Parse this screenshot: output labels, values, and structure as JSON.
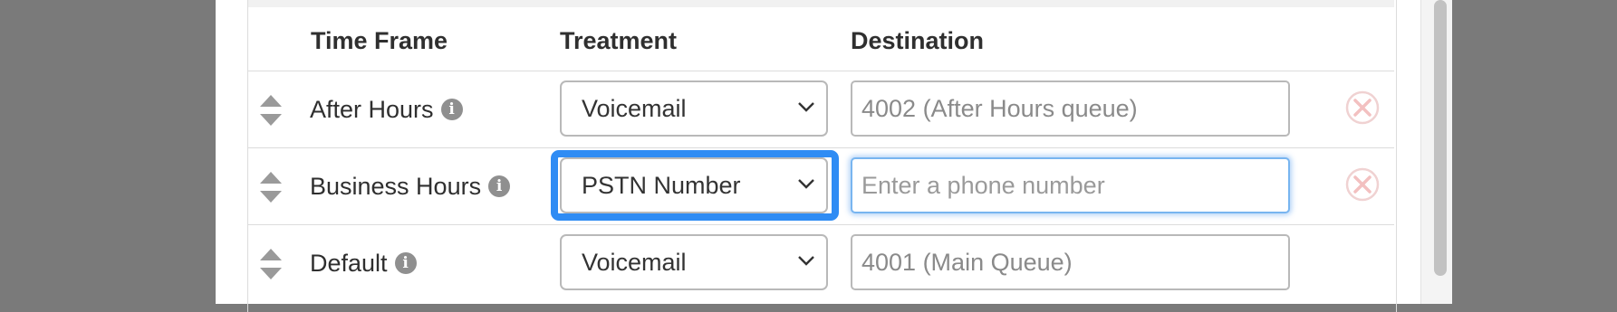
{
  "table": {
    "headers": {
      "time_frame": "Time Frame",
      "treatment": "Treatment",
      "destination": "Destination"
    },
    "rows": [
      {
        "label": "After Hours",
        "treatment": "Voicemail",
        "destination_value": "4002 (After Hours queue)",
        "destination_placeholder": ""
      },
      {
        "label": "Business Hours",
        "treatment": "PSTN Number",
        "destination_value": "",
        "destination_placeholder": "Enter a phone number"
      },
      {
        "label": "Default",
        "treatment": "Voicemail",
        "destination_value": "4001 (Main Queue)",
        "destination_placeholder": ""
      }
    ]
  },
  "icons": {
    "drag": "drag-handle-icon",
    "info": "info-icon",
    "chevron": "chevron-down-icon",
    "remove": "remove-icon"
  },
  "colors": {
    "focus": "#2f8cf4",
    "remove_icon": "#f3c9c9",
    "header_text": "#2f2f2f"
  }
}
